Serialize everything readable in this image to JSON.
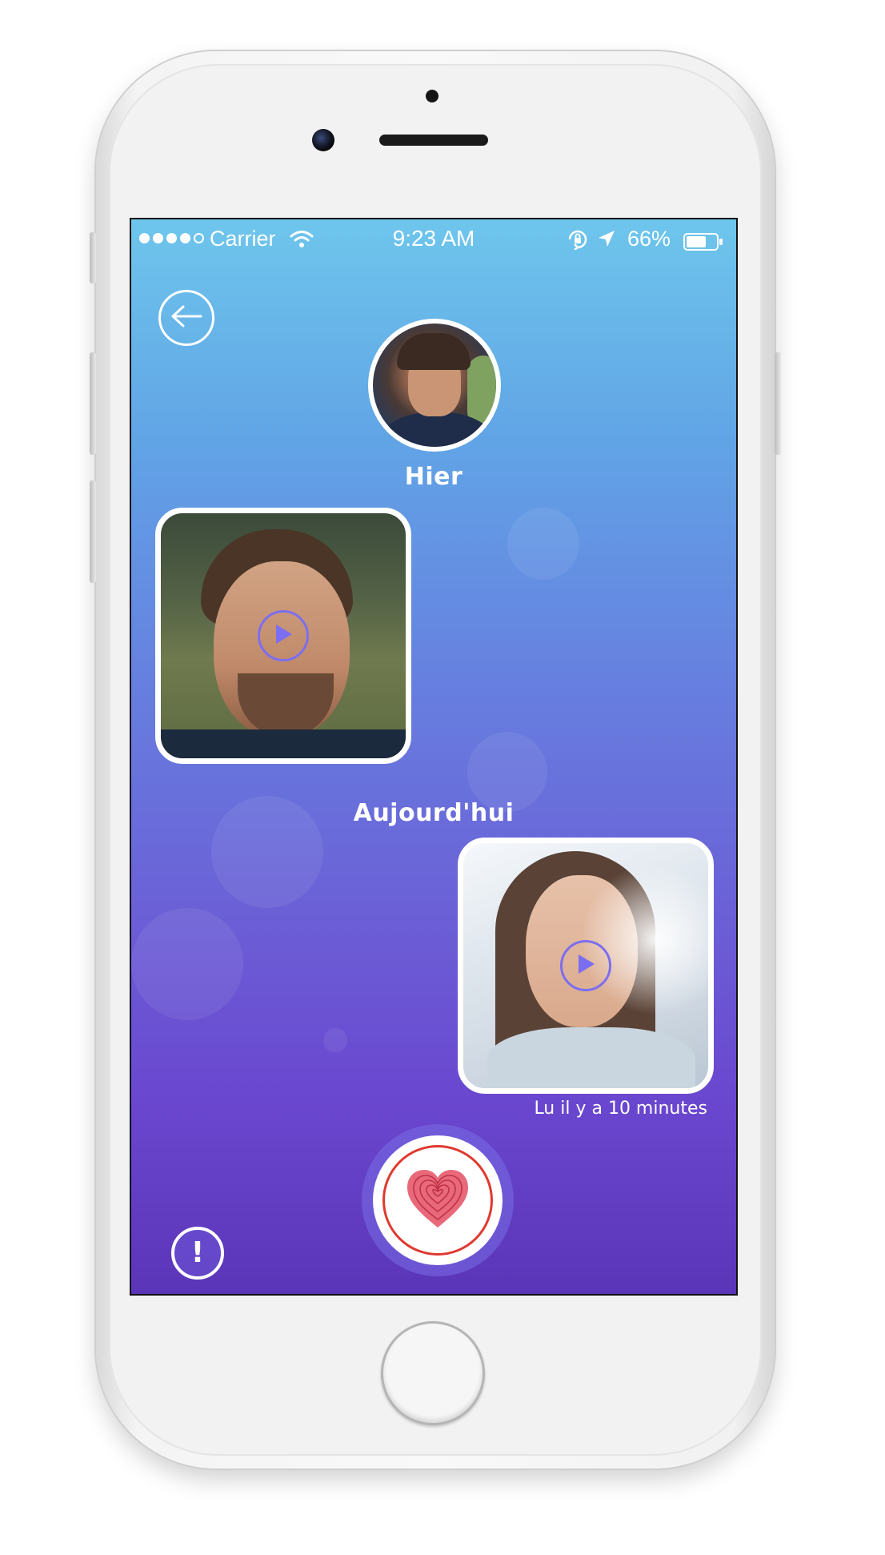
{
  "status_bar": {
    "carrier": "Carrier",
    "time": "9:23 AM",
    "battery_percent": "66%",
    "signal_bars_filled": 4,
    "signal_bars_total": 5,
    "battery_level": 0.66
  },
  "conversation": {
    "sections": [
      {
        "label": "Hier"
      },
      {
        "label": "Aujourd'hui"
      }
    ],
    "read_status": "Lu il y a 10 minutes"
  },
  "alert": {
    "glyph": "!"
  },
  "colors": {
    "gradient_top": "#6ec6ec",
    "gradient_bottom": "#5b35b8",
    "record_accent": "#e0392f",
    "play_accent": "#7c6ef0"
  },
  "icons": [
    "back-arrow-icon",
    "wifi-icon",
    "orientation-lock-icon",
    "location-arrow-icon",
    "battery-icon",
    "play-icon",
    "fingerprint-heart-icon",
    "exclamation-icon"
  ]
}
